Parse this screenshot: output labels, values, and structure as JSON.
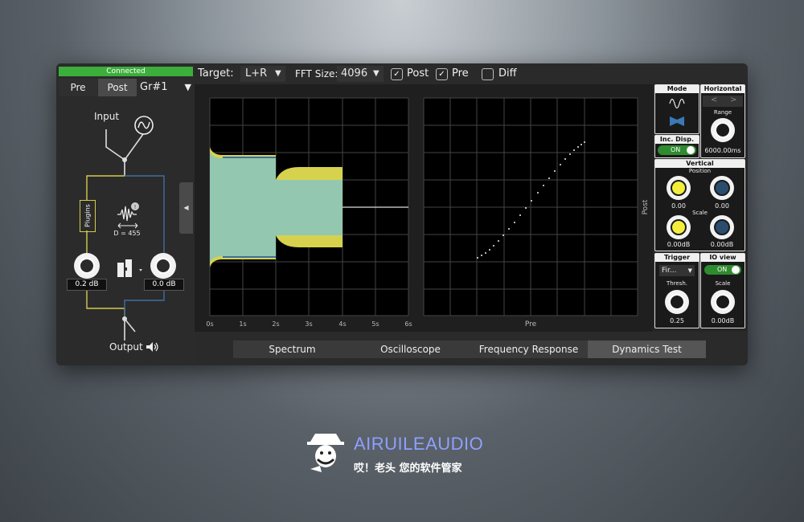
{
  "status": {
    "connected": "Connected"
  },
  "left": {
    "pre": "Pre",
    "post": "Post",
    "group": "Gr#1",
    "input": "Input",
    "output": "Output",
    "plugins": "Plugins",
    "delay": "D = 455",
    "gain_left": "0.2 dB",
    "gain_right": "0.0 dB"
  },
  "toolbar": {
    "target_label": "Target:",
    "target_value": "L+R",
    "fft_label": "FFT Size:",
    "fft_value": "4096",
    "post": "Post",
    "pre": "Pre",
    "diff": "Diff",
    "post_checked": true,
    "pre_checked": true,
    "diff_checked": false
  },
  "plot1": {
    "x_ticks": [
      "0s",
      "1s",
      "2s",
      "3s",
      "4s",
      "5s",
      "6s"
    ]
  },
  "plot2": {
    "xlabel": "Pre",
    "ylabel": "Post"
  },
  "controls": {
    "mode": "Mode",
    "horizontal": "Horizontal",
    "range": "Range",
    "range_value": "6000.00ms",
    "inc_disp": "Inc. Disp.",
    "inc_disp_state": "ON",
    "vertical": "Vertical",
    "position": "Position",
    "scale": "Scale",
    "pos1": "0.00",
    "pos2": "0.00",
    "scale1": "0.00dB",
    "scale2": "0.00dB",
    "trigger": "Trigger",
    "trigger_value": "Fir...",
    "thresh": "Thresh.",
    "thresh_value": "0.25",
    "io_view": "IO view",
    "io_state": "ON",
    "io_scale": "Scale",
    "io_scale_value": "0.00dB"
  },
  "tabs": [
    "Spectrum",
    "Oscilloscope",
    "Frequency Response",
    "Dynamics Test"
  ],
  "active_tab": "Dynamics Test",
  "brand": {
    "name": "AIRUILEAUDIO",
    "tagline": "哎！老头 您的软件管家"
  },
  "colors": {
    "accent_green": "#3cae3c",
    "knob_yellow": "#f3ee3c",
    "knob_blue": "#2a4d6e",
    "brand": "#8ea0ff"
  }
}
